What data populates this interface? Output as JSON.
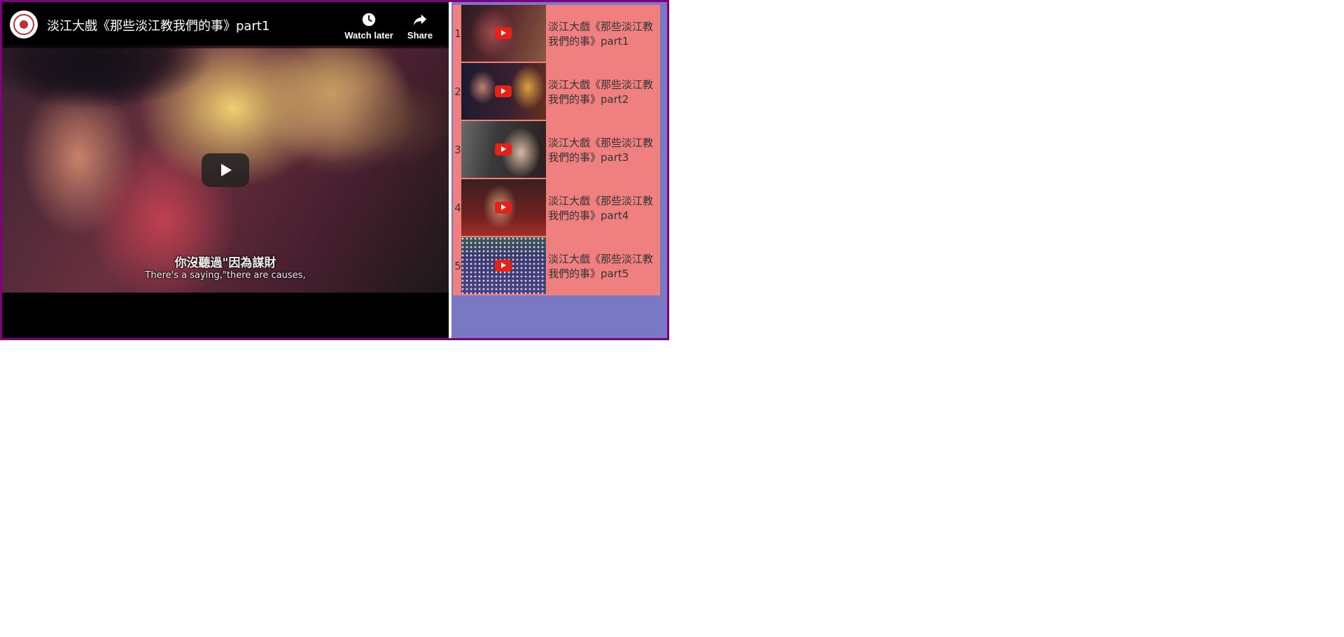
{
  "player": {
    "title": "淡江大戲《那些淡江教我們的事》part1",
    "actions": {
      "watch_later": "Watch later",
      "share": "Share"
    },
    "subtitles": {
      "zh": "你沒聽過\"因為謀財",
      "en": "There's a saying,\"there are causes,"
    }
  },
  "playlist": {
    "items": [
      {
        "index": "1",
        "title": "淡江大戲《那些淡江教我們的事》part1"
      },
      {
        "index": "2",
        "title": "淡江大戲《那些淡江教我們的事》part2"
      },
      {
        "index": "3",
        "title": "淡江大戲《那些淡江教我們的事》part3"
      },
      {
        "index": "4",
        "title": "淡江大戲《那些淡江教我們的事》part4"
      },
      {
        "index": "5",
        "title": "淡江大戲《那些淡江教我們的事》part5"
      }
    ]
  },
  "colors": {
    "frame_border": "#800080",
    "panel_background": "#7a78c2",
    "playlist_background": "#f08080",
    "youtube_red": "#e62117"
  },
  "icons": {
    "watch_later": "clock-icon",
    "share": "share-arrow-icon",
    "play": "play-icon",
    "channel": "channel-logo"
  }
}
